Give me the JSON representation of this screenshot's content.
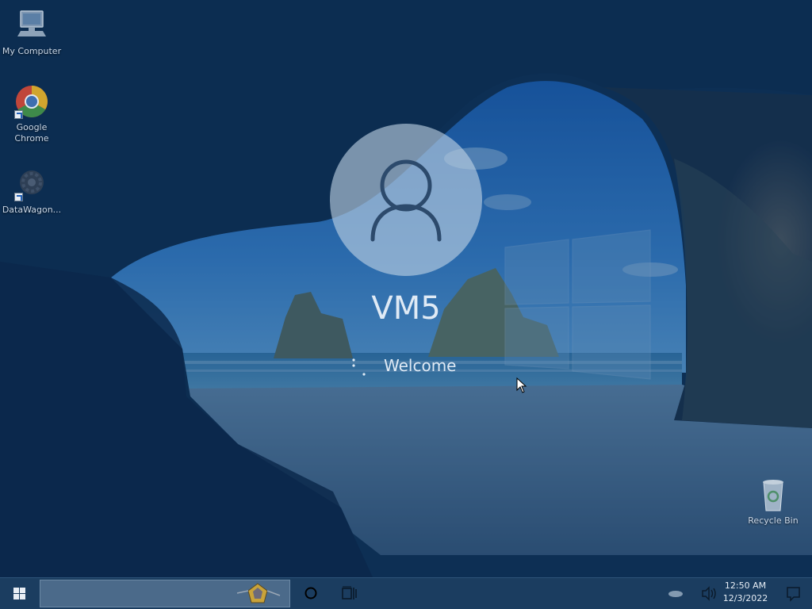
{
  "desktop": {
    "icons": [
      {
        "label": "My Computer",
        "icon": "computer-icon",
        "shortcut": false
      },
      {
        "label": "Google Chrome",
        "icon": "chrome-icon",
        "shortcut": true
      },
      {
        "label": "DataWagon...",
        "icon": "datawagon-gear-icon",
        "shortcut": true
      },
      {
        "label": "Recycle Bin",
        "icon": "recycle-bin-icon",
        "shortcut": false
      }
    ]
  },
  "login": {
    "user_name": "VM5",
    "status_text": "Welcome",
    "avatar_icon": "user-silhouette-icon"
  },
  "taskbar": {
    "start_icon": "windows-logo-icon",
    "search_placeholder": "",
    "cortana_icon": "cortana-circle-icon",
    "task_view_icon": "task-view-icon",
    "tray": {
      "network_icon": "network-icon",
      "volume_icon": "volume-icon",
      "time": "12:50 AM",
      "date": "12/3/2022",
      "notification_icon": "action-center-icon"
    }
  },
  "colors": {
    "taskbar": "#1b3d60",
    "overlay_tint": "#0a376e",
    "text_light": "#dfeaf5",
    "icon_label": "#c9d6e6"
  }
}
